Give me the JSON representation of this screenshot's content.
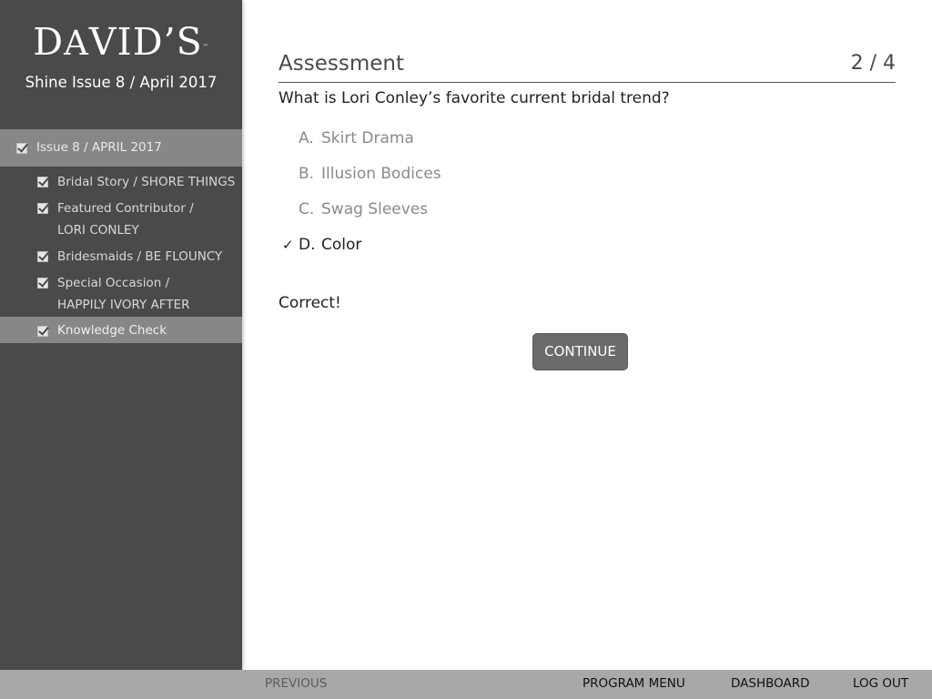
{
  "brand": {
    "logo_text": "DAVID'S",
    "trademark": "™"
  },
  "sidebar": {
    "issue_title": "Shine Issue 8 / April 2017",
    "parent": {
      "label": "Issue 8 / APRIL 2017",
      "checked": true
    },
    "items": [
      {
        "line1": "Bridal Story / SHORE THINGS",
        "line2": "",
        "checked": true,
        "active": false
      },
      {
        "line1": "Featured Contributor /",
        "line2": "LORI CONLEY",
        "checked": true,
        "active": false
      },
      {
        "line1": "Bridesmaids / BE FLOUNCY",
        "line2": "",
        "checked": true,
        "active": false
      },
      {
        "line1": "Special Occasion /",
        "line2": "HAPPILY IVORY AFTER",
        "checked": true,
        "active": false
      },
      {
        "line1": "Knowledge Check",
        "line2": "",
        "checked": true,
        "active": true
      }
    ]
  },
  "assessment": {
    "title": "Assessment",
    "counter": "2 / 4",
    "question": "What is Lori Conley’s favorite current bridal trend?",
    "options": [
      {
        "letter": "A.",
        "text": "Skirt Drama",
        "selected": false
      },
      {
        "letter": "B.",
        "text": "Illusion Bodices",
        "selected": false
      },
      {
        "letter": "C.",
        "text": "Swag Sleeves",
        "selected": false
      },
      {
        "letter": "D.",
        "text": "Color",
        "selected": true,
        "mark": "✓"
      }
    ],
    "feedback": "Correct!",
    "continue_label": "CONTINUE"
  },
  "footer": {
    "previous": "PREVIOUS",
    "program_menu": "PROGRAM MENU",
    "dashboard": "DASHBOARD",
    "logout": "LOG OUT"
  },
  "colors": {
    "sidebar_bg": "#4a4a4a",
    "highlight_bg": "#878787",
    "footer_bg": "#a8a8a8",
    "button_bg": "#6b6b6b"
  }
}
